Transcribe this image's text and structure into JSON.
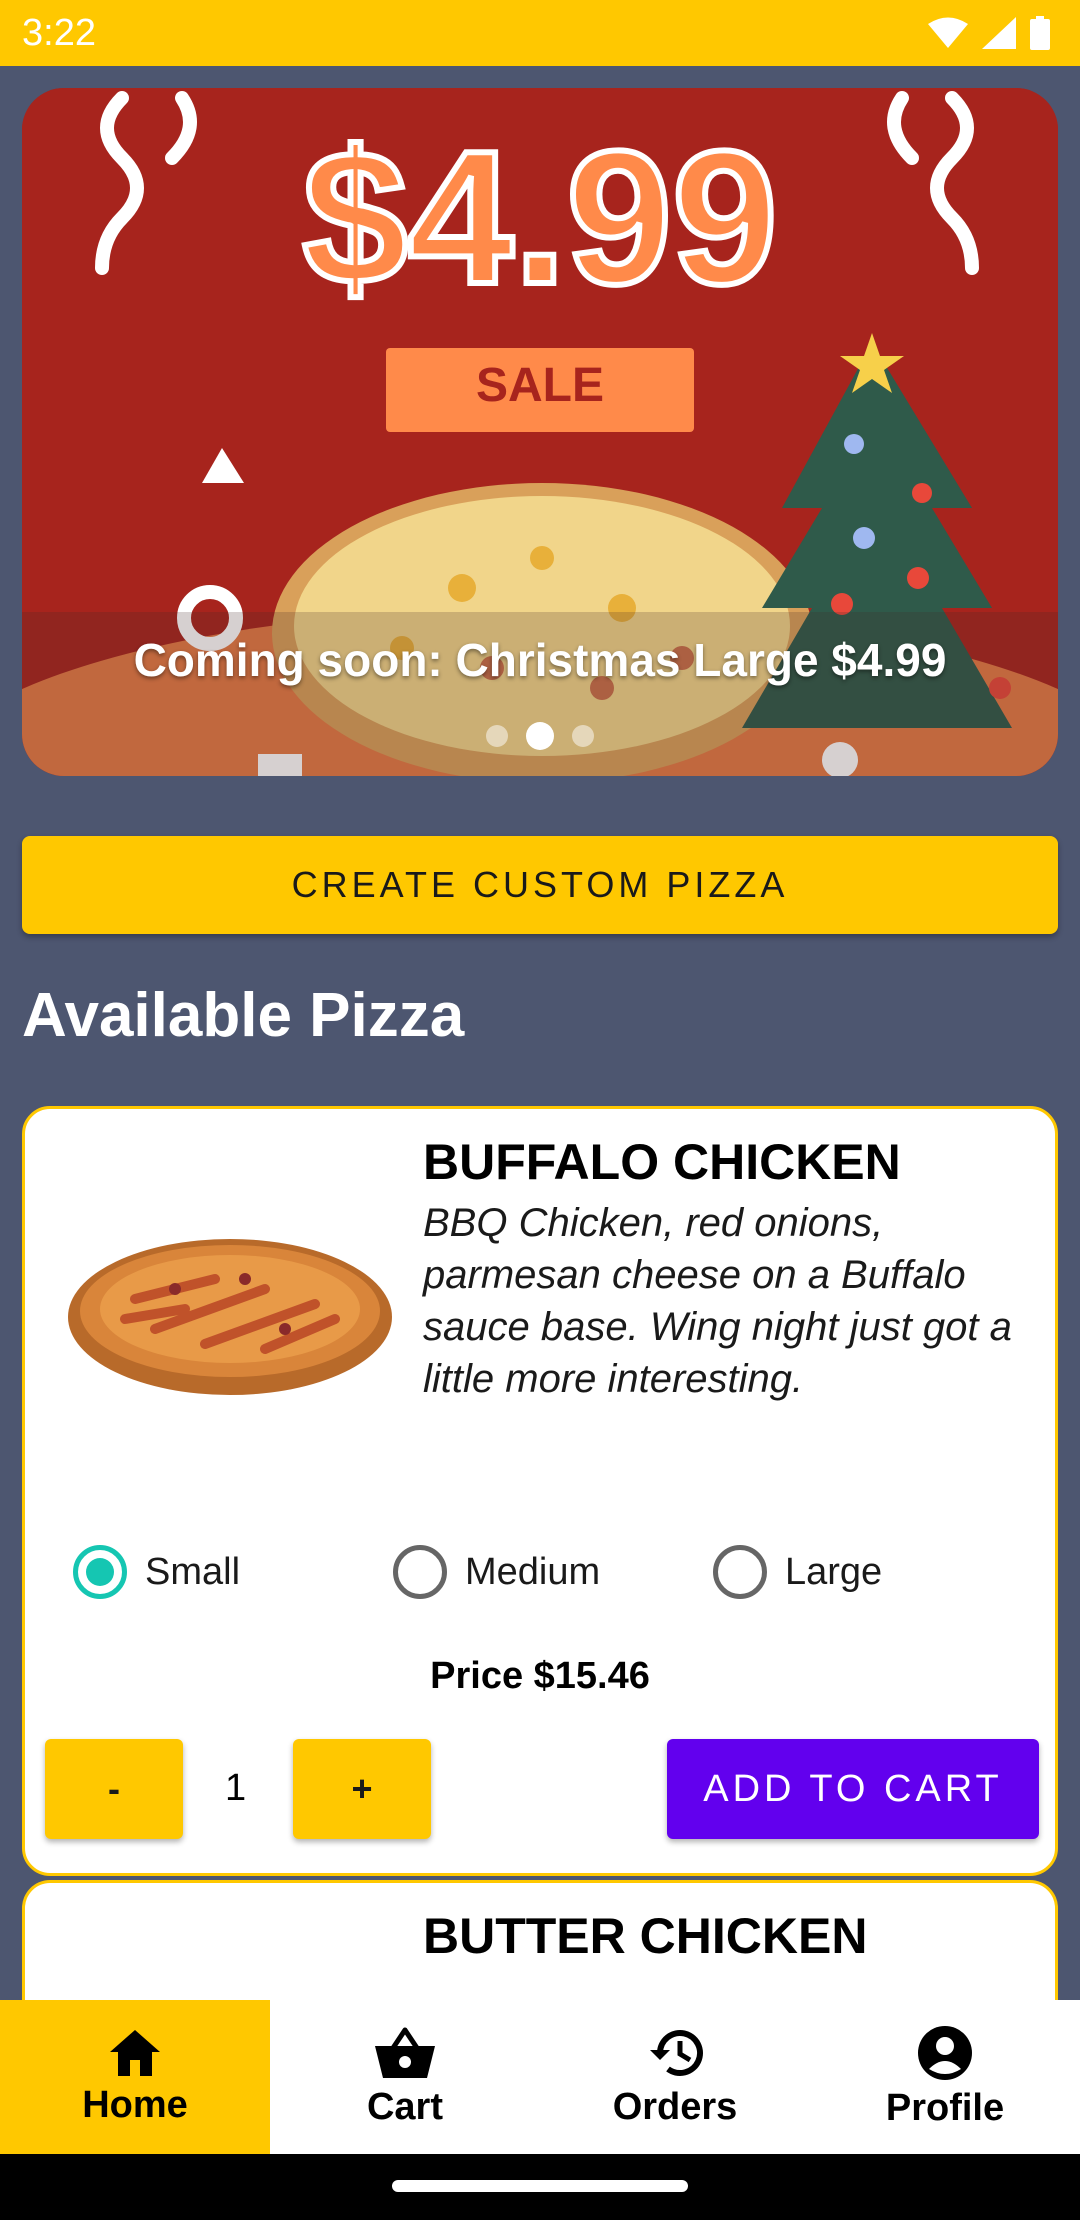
{
  "status_bar": {
    "time": "3:22",
    "icons": [
      "wifi-icon",
      "signal-icon",
      "battery-icon"
    ]
  },
  "banner": {
    "price_text": "$4.99",
    "sale_text": "SALE",
    "caption": "Coming soon: Christmas Large $4.99",
    "slide_count": 3,
    "active_slide": 2
  },
  "create_button": {
    "label": "CREATE CUSTOM PIZZA"
  },
  "section_title": "Available Pizza",
  "pizzas": [
    {
      "name": "BUFFALO CHICKEN",
      "description": "BBQ Chicken, red onions, parmesan cheese on a Buffalo sauce base. Wing night just got a little more interesting.",
      "sizes": [
        {
          "label": "Small",
          "selected": true
        },
        {
          "label": "Medium",
          "selected": false
        },
        {
          "label": "Large",
          "selected": false
        }
      ],
      "price": "Price $15.46",
      "quantity": "1",
      "minus_label": "-",
      "plus_label": "+",
      "add_label": "ADD TO CART"
    },
    {
      "name": "BUTTER CHICKEN"
    }
  ],
  "nav": {
    "items": [
      {
        "label": "Home",
        "icon": "home-icon",
        "active": true
      },
      {
        "label": "Cart",
        "icon": "basket-icon",
        "active": false
      },
      {
        "label": "Orders",
        "icon": "history-icon",
        "active": false
      },
      {
        "label": "Profile",
        "icon": "account-icon",
        "active": false
      }
    ]
  },
  "colors": {
    "accent": "#ffc800",
    "primary": "#6200ee",
    "radio": "#15c6b2",
    "background": "#4d5670",
    "banner_red": "#a7241d"
  }
}
